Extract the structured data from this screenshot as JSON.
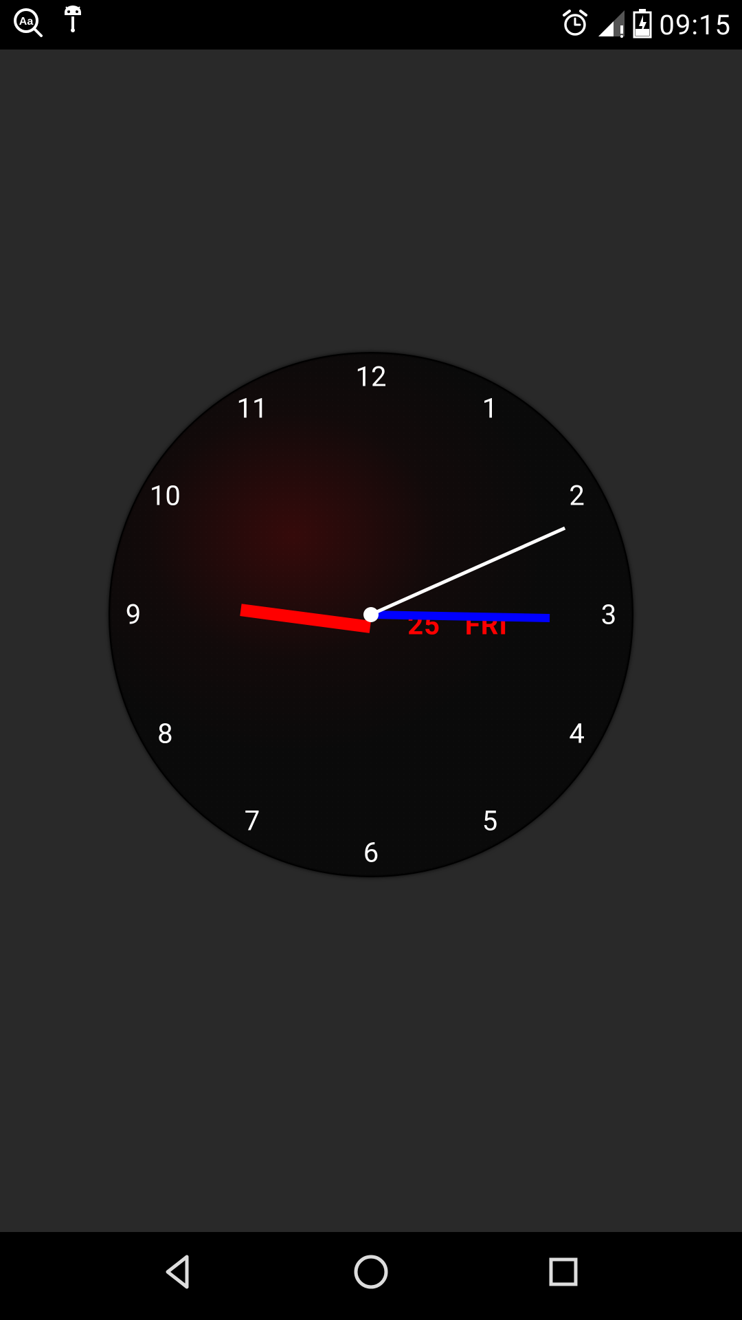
{
  "status_bar": {
    "time_text": "09:15",
    "icons": {
      "left": [
        "aa-search-icon",
        "android-debug-icon"
      ],
      "right": [
        "alarm-icon",
        "signal-icon",
        "battery-charging-icon"
      ]
    }
  },
  "clock": {
    "numerals": [
      "12",
      "1",
      "2",
      "3",
      "4",
      "5",
      "6",
      "7",
      "8",
      "9",
      "10",
      "11"
    ],
    "date_number": "25",
    "date_day": "FRI",
    "time": {
      "hour": 9,
      "minute": 15,
      "second": 11
    },
    "colors": {
      "hour_hand": "#ff0000",
      "minute_hand": "#0000ff",
      "second_hand": "#ffffff",
      "date_text": "#ff0000"
    }
  },
  "nav_bar": {
    "buttons": [
      "back",
      "home",
      "recents"
    ]
  }
}
